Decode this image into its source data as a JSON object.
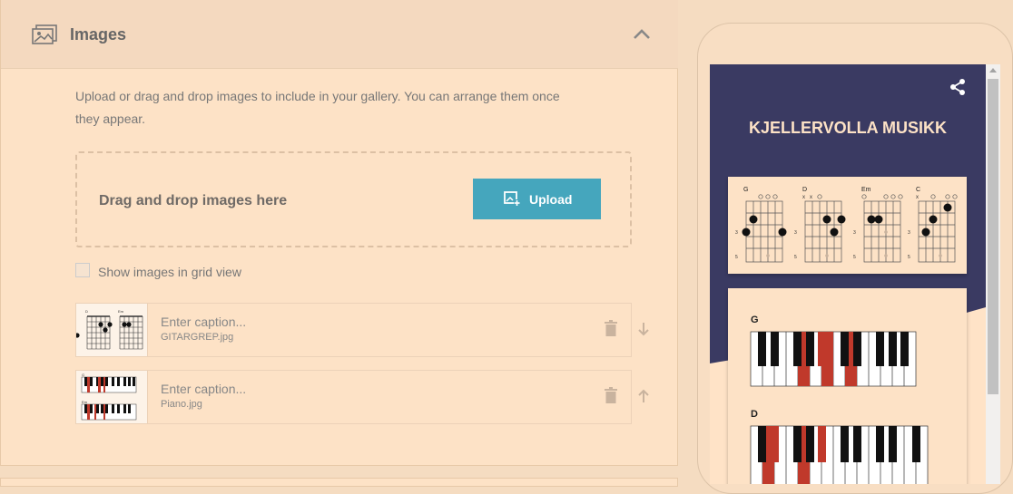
{
  "section": {
    "title": "Images",
    "icon": "image-gallery-icon",
    "collapse_icon": "chevron-up-icon"
  },
  "description": "Upload or drag and drop images to include in your gallery. You can arrange them once they appear.",
  "dropzone": {
    "text": "Drag and drop images here",
    "upload_label": "Upload",
    "upload_icon": "add-image-icon"
  },
  "grid_view": {
    "label": "Show images in grid view",
    "checked": false
  },
  "images": [
    {
      "caption_placeholder": "Enter caption...",
      "filename": "GITARGREP.jpg",
      "move_icon": "arrow-down-icon"
    },
    {
      "caption_placeholder": "Enter caption...",
      "filename": "Piano.jpg",
      "move_icon": "arrow-up-icon"
    }
  ],
  "preview": {
    "site_title": "KJELLERVOLLA MUSIKK",
    "share_icon": "share-icon",
    "header_color": "#3a3a62",
    "background_color": "#ffe3c7",
    "accent_color": "#45a6bd",
    "guitar_chords": [
      "G",
      "D",
      "Em",
      "C"
    ],
    "fret_numbers": [
      "3",
      "5"
    ],
    "piano_chords": [
      "G",
      "D"
    ]
  }
}
